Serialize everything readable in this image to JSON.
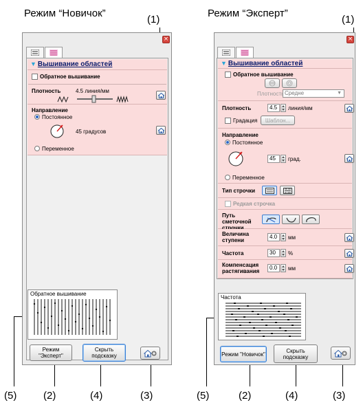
{
  "left": {
    "mode_title": "Режим “Новичок”",
    "section_title": "Вышивание областей",
    "reverse_label": "Обратное вышивание",
    "density_label": "Плотность",
    "density_value": "4.5 линия/мм",
    "direction_label": "Направление",
    "constant_label": "Постоянное",
    "angle_value": "45 градусов",
    "variable_label": "Переменное",
    "preview_label": "Обратное вышивание",
    "expert_button": "Режим \"Эксперт\"",
    "hint_button": "Скрыть подсказку"
  },
  "right": {
    "mode_title": "Режим “Эксперт”",
    "section_title": "Вышивание областей",
    "reverse_label": "Обратное вышивание",
    "density_small_label": "Плотность",
    "density_select": "Средне",
    "density_label": "Плотность",
    "density_value": "4.5",
    "density_unit": "линия/мм",
    "gradation_label": "Градация",
    "template_button": "Шаблон...",
    "direction_label": "Направление",
    "constant_label": "Постоянное",
    "angle_value": "45",
    "angle_unit": "град.",
    "variable_label": "Переменное",
    "stitch_type_label": "Тип строчки",
    "sparse_label": "Редкая строчка",
    "offset_path_label": "Путь сметочной строчки",
    "step_label": "Величина ступени",
    "step_value": "4.0",
    "step_unit": "мм",
    "freq_label": "Частота",
    "freq_value": "30",
    "freq_unit": "%",
    "comp_label": "Компенсация растягивания",
    "comp_value": "0.0",
    "comp_unit": "мм",
    "preview_label": "Частота",
    "novice_button": "Режим \"Новичок\"",
    "hint_button": "Скрыть подсказку"
  },
  "callouts": {
    "c1": "(1)",
    "c2": "(2)",
    "c3": "(3)",
    "c4": "(4)",
    "c5": "(5)"
  },
  "colors": {
    "section_bg": "#fbdcdc",
    "title_blue": "#0a1a6b",
    "close_red": "#d6453d",
    "focus_blue": "#3b7fd4"
  }
}
